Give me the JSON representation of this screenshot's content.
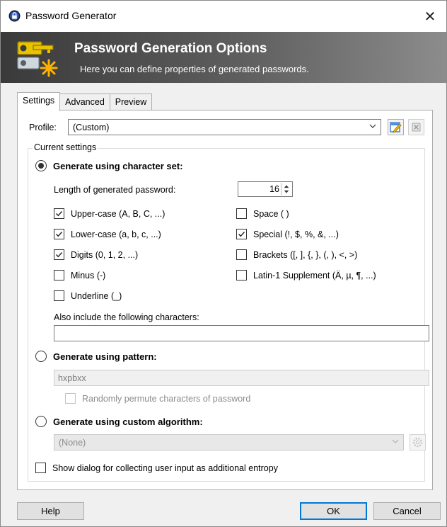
{
  "window": {
    "title": "Password Generator",
    "close_glyph": "✕"
  },
  "banner": {
    "title": "Password Generation Options",
    "subtitle": "Here you can define properties of generated passwords.",
    "icon": "key-star-icon"
  },
  "tabs": [
    {
      "label": "Settings",
      "active": true
    },
    {
      "label": "Advanced",
      "active": false
    },
    {
      "label": "Preview",
      "active": false
    }
  ],
  "profile": {
    "label": "Profile:",
    "value": "(Custom)"
  },
  "current_settings": {
    "legend": "Current settings"
  },
  "charset": {
    "radio_label": "Generate using character set:",
    "selected": true,
    "length_label": "Length of generated password:",
    "length_value": "16",
    "options_left": [
      {
        "label": "Upper-case (A, B, C, ...)",
        "checked": true
      },
      {
        "label": "Lower-case (a, b, c, ...)",
        "checked": true
      },
      {
        "label": "Digits (0, 1, 2, ...)",
        "checked": true
      },
      {
        "label": "Minus (-)",
        "checked": false
      },
      {
        "label": "Underline (_)",
        "checked": false
      }
    ],
    "options_right": [
      {
        "label": "Space ( )",
        "checked": false
      },
      {
        "label": "Special (!, $, %, &, ...)",
        "checked": true
      },
      {
        "label": "Brackets ([, ], {, }, (, ), <, >)",
        "checked": false
      },
      {
        "label": "Latin-1 Supplement (Ä, µ, ¶, ...)",
        "checked": false
      }
    ],
    "also_include_label": "Also include the following characters:",
    "also_include_value": ""
  },
  "pattern": {
    "radio_label": "Generate using pattern:",
    "selected": false,
    "value": "hxpbxx",
    "permute_label": "Randomly permute characters of password",
    "permute_checked": false
  },
  "custom_algorithm": {
    "radio_label": "Generate using custom algorithm:",
    "selected": false,
    "value": "(None)"
  },
  "entropy": {
    "label": "Show dialog for collecting user input as additional entropy",
    "checked": false
  },
  "buttons": {
    "help": "Help",
    "ok": "OK",
    "cancel": "Cancel"
  }
}
